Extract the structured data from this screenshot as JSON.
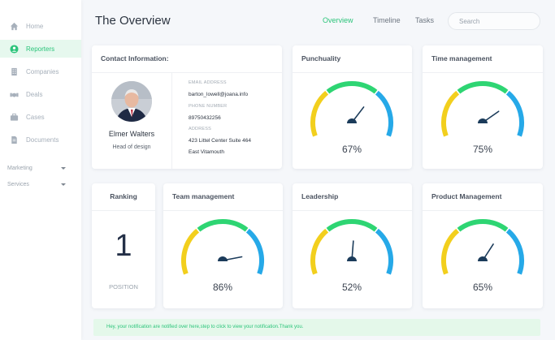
{
  "sidebar": {
    "items": [
      {
        "label": "Home",
        "icon": "home-icon",
        "active": false
      },
      {
        "label": "Reporters",
        "icon": "user-circle-icon",
        "active": true
      },
      {
        "label": "Companies",
        "icon": "building-icon",
        "active": false
      },
      {
        "label": "Deals",
        "icon": "handshake-icon",
        "active": false
      },
      {
        "label": "Cases",
        "icon": "briefcase-icon",
        "active": false
      },
      {
        "label": "Documents",
        "icon": "document-icon",
        "active": false
      }
    ],
    "groups": [
      {
        "label": "Marketing"
      },
      {
        "label": "Services"
      }
    ]
  },
  "header": {
    "title": "The Overview",
    "tabs": [
      {
        "label": "Overview",
        "active": true
      },
      {
        "label": "Timeline",
        "active": false
      },
      {
        "label": "Tasks",
        "active": false
      }
    ],
    "search_placeholder": "Search"
  },
  "contact": {
    "title": "Contact Information:",
    "name": "Elmer Walters",
    "role": "Head of design",
    "email_label": "EMAIL ADDRESS",
    "email": "barton_lowell@joana.info",
    "phone_label": "PHONE NUMBER",
    "phone": "89750432256",
    "address_label": "ADDRESS",
    "address_line1": "423 Littel Center Suite 464",
    "address_line2": "East Vitamouth"
  },
  "ranking": {
    "title": "Ranking",
    "value": "1",
    "label": "POSITION"
  },
  "metrics": {
    "punchuality": {
      "title": "Punchuality",
      "value": "67%",
      "percent": 67
    },
    "time_management": {
      "title": "Time management",
      "value": "75%",
      "percent": 75
    },
    "team_management": {
      "title": "Team management",
      "value": "86%",
      "percent": 86
    },
    "leadership": {
      "title": "Leadership",
      "value": "52%",
      "percent": 52
    },
    "product_management": {
      "title": "Product Management",
      "value": "65%",
      "percent": 65
    }
  },
  "colors": {
    "accent": "#2bc47a",
    "gauge_yellow": "#f2cf1d",
    "gauge_green": "#2ed573",
    "gauge_blue": "#26a9e8",
    "needle": "#1b3b5a"
  },
  "notification": {
    "text": "Hey, your notification are notified over here,step to click to view your notification.Thank you."
  }
}
